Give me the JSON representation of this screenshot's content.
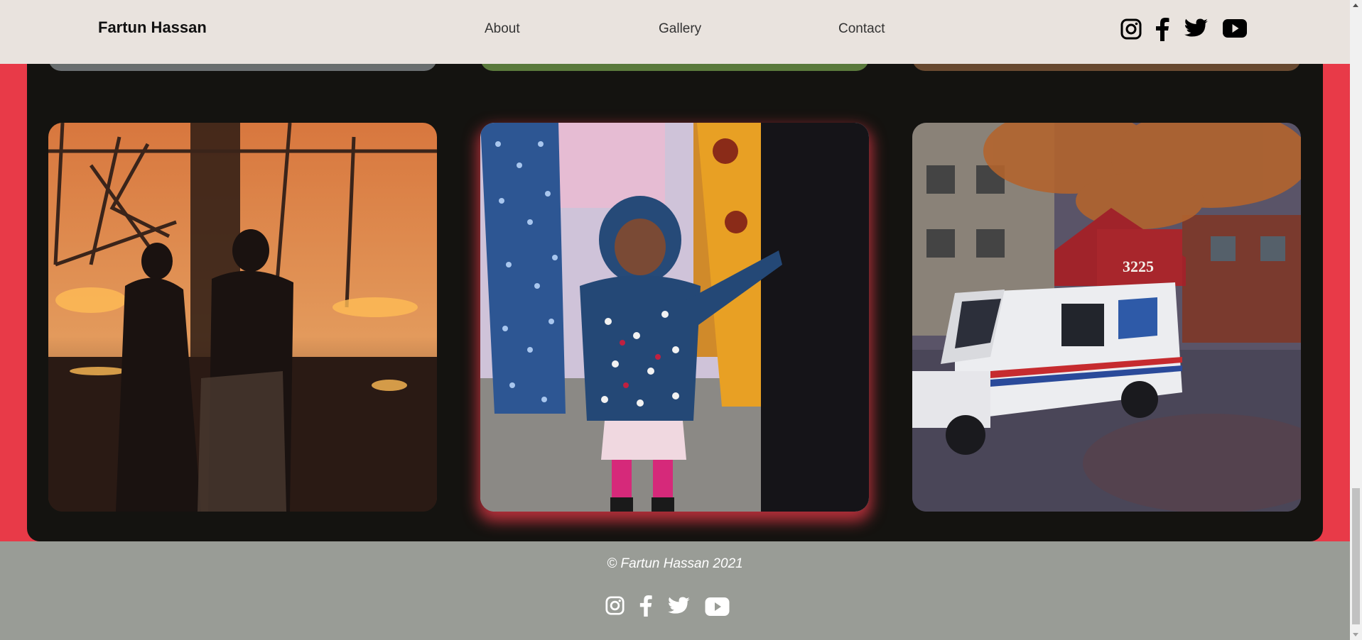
{
  "header": {
    "site_title": "Fartun Hassan",
    "nav": [
      {
        "label": "About"
      },
      {
        "label": "Gallery"
      },
      {
        "label": "Contact"
      }
    ],
    "social_icons": [
      "instagram-icon",
      "facebook-icon",
      "twitter-icon",
      "youtube-icon"
    ]
  },
  "gallery": {
    "photos": [
      {
        "subject": "two silhouetted figures watching a fire at night"
      },
      {
        "subject": "young child in blue polka-dot hooded jacket in a hair salon"
      },
      {
        "subject": "USPS mail truck parked by building 3225 in autumn"
      }
    ],
    "building_number": "3225"
  },
  "footer": {
    "copyright": "© Fartun Hassan 2021",
    "social_icons": [
      "instagram-icon",
      "facebook-icon",
      "twitter-icon",
      "youtube-icon"
    ]
  },
  "colors": {
    "accent": "#e83a48",
    "panel": "#141310",
    "header_bg": "#e9e3de",
    "footer_bg": "#999c96"
  }
}
